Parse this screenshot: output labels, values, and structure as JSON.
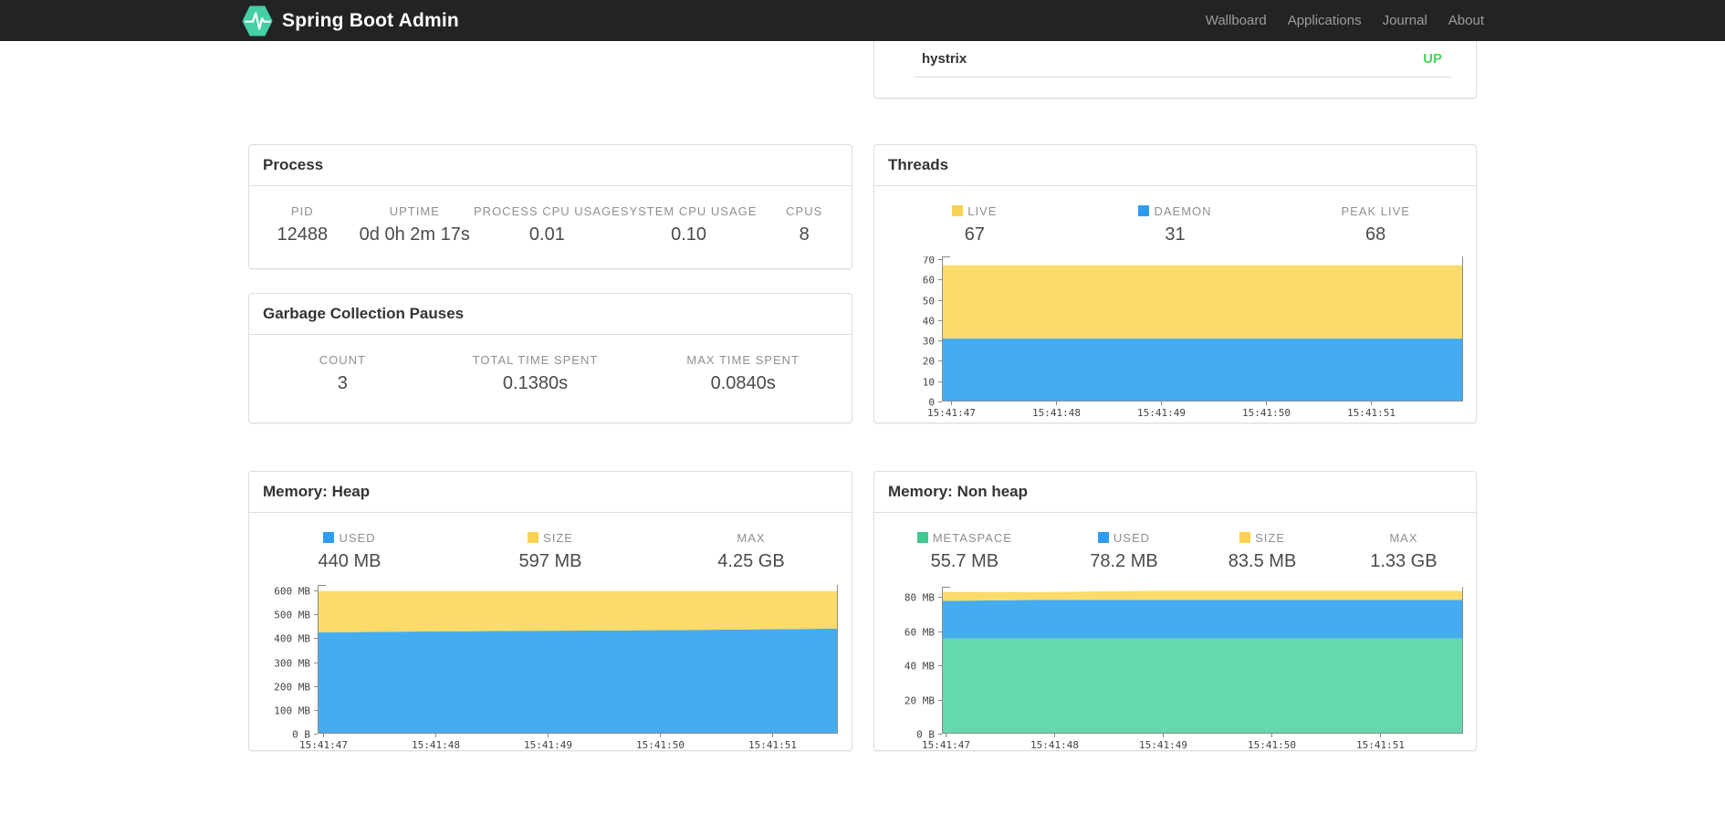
{
  "navbar": {
    "brand": "Spring Boot Admin",
    "items": [
      {
        "label": "Wallboard"
      },
      {
        "label": "Applications"
      },
      {
        "label": "Journal"
      },
      {
        "label": "About"
      }
    ],
    "brand_color": "#45cfa5",
    "bg_color": "#222325"
  },
  "status_panel": {
    "application": "hystrix",
    "status": "UP",
    "status_color": "#43d65f"
  },
  "process": {
    "title": "Process",
    "stats": [
      {
        "label": "PID",
        "value": "12488"
      },
      {
        "label": "UPTIME",
        "value": "0d 0h 2m 17s"
      },
      {
        "label": "PROCESS CPU USAGE",
        "value": "0.01"
      },
      {
        "label": "SYSTEM CPU USAGE",
        "value": "0.10"
      },
      {
        "label": "CPUS",
        "value": "8"
      }
    ]
  },
  "gc": {
    "title": "Garbage Collection Pauses",
    "stats": [
      {
        "label": "COUNT",
        "value": "3"
      },
      {
        "label": "TOTAL TIME SPENT",
        "value": "0.1380s"
      },
      {
        "label": "MAX TIME SPENT",
        "value": "0.0840s"
      }
    ]
  },
  "threads": {
    "title": "Threads",
    "stats": [
      {
        "label": "LIVE",
        "value": "67",
        "swatch": "#f7d254"
      },
      {
        "label": "DAEMON",
        "value": "31",
        "swatch": "#2e9bef"
      },
      {
        "label": "PEAK LIVE",
        "value": "68"
      }
    ]
  },
  "heap": {
    "title": "Memory: Heap",
    "stats": [
      {
        "label": "USED",
        "value": "440 MB",
        "swatch": "#2e9bef"
      },
      {
        "label": "SIZE",
        "value": "597 MB",
        "swatch": "#f7d254"
      },
      {
        "label": "MAX",
        "value": "4.25 GB"
      }
    ]
  },
  "nonheap": {
    "title": "Memory: Non heap",
    "stats": [
      {
        "label": "METASPACE",
        "value": "55.7 MB",
        "swatch": "#3fc98e"
      },
      {
        "label": "USED",
        "value": "78.2 MB",
        "swatch": "#2e9bef"
      },
      {
        "label": "SIZE",
        "value": "83.5 MB",
        "swatch": "#f7d254"
      },
      {
        "label": "MAX",
        "value": "1.33 GB"
      }
    ]
  },
  "chart_data": [
    {
      "id": "threads",
      "type": "area",
      "title": "Threads",
      "stacked": true,
      "x": [
        "15:41:47",
        "15:41:48",
        "15:41:49",
        "15:41:50",
        "15:41:51"
      ],
      "ymax": 70,
      "yticks": [
        0,
        10,
        20,
        30,
        40,
        50,
        60,
        70
      ],
      "ytick_labels": [
        "0",
        "10",
        "20",
        "30",
        "40",
        "50",
        "60",
        "70"
      ],
      "grid": false,
      "legend_position": "none",
      "series": [
        {
          "name": "DAEMON",
          "color": "#45acf0",
          "values": [
            31,
            31,
            31,
            31,
            31,
            31
          ]
        },
        {
          "name": "LIVE",
          "color": "#fbdb69",
          "values": [
            67,
            67,
            67,
            67,
            67,
            67
          ]
        }
      ]
    },
    {
      "id": "heap",
      "type": "area",
      "title": "Memory: Heap",
      "stacked": true,
      "x": [
        "15:41:47",
        "15:41:48",
        "15:41:49",
        "15:41:50",
        "15:41:51"
      ],
      "ymax": 600,
      "yticks": [
        0,
        100,
        200,
        300,
        400,
        500,
        600
      ],
      "ytick_labels": [
        "0 B",
        "100 MB",
        "200 MB",
        "300 MB",
        "400 MB",
        "500 MB",
        "600 MB"
      ],
      "grid": false,
      "legend_position": "none",
      "series": [
        {
          "name": "USED",
          "color": "#45acf0",
          "values": [
            424,
            428,
            431,
            433,
            436,
            440
          ]
        },
        {
          "name": "SIZE",
          "color": "#fbdb69",
          "values": [
            597,
            597,
            597,
            597,
            597,
            597
          ]
        }
      ]
    },
    {
      "id": "nonheap",
      "type": "area",
      "title": "Memory: Non heap",
      "stacked": true,
      "x": [
        "15:41:47",
        "15:41:48",
        "15:41:49",
        "15:41:50",
        "15:41:51"
      ],
      "ymax": 80,
      "yticks": [
        0,
        20,
        40,
        60,
        80
      ],
      "ytick_labels": [
        "0 B",
        "20 MB",
        "40 MB",
        "60 MB",
        "80 MB"
      ],
      "grid": false,
      "legend_position": "none",
      "series": [
        {
          "name": "METASPACE",
          "color": "#65d8ad",
          "values": [
            55.7,
            55.7,
            55.7,
            55.7,
            55.7,
            55.7
          ]
        },
        {
          "name": "USED",
          "color": "#45acf0",
          "values": [
            77.6,
            78.2,
            78.2,
            78.2,
            78.2,
            78.2
          ]
        },
        {
          "name": "SIZE",
          "color": "#fbdb69",
          "values": [
            82.8,
            82.8,
            83.5,
            83.5,
            83.5,
            83.5
          ]
        }
      ]
    }
  ]
}
